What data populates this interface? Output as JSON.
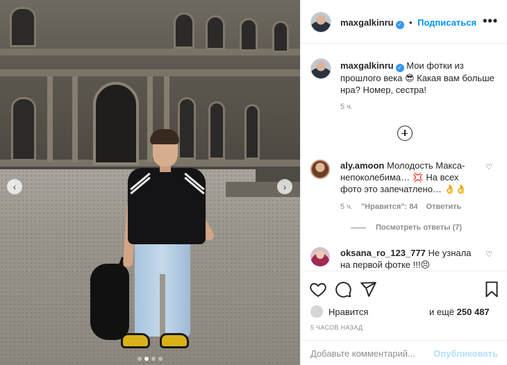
{
  "post": {
    "author": "maxgalkinru",
    "follow_label": "Подписаться",
    "more_icon": "•••",
    "caption_text": "Мои фотки из прошлого века 😎 Какая вам больше нра? Номер, сестра!",
    "caption_time": "5 ч."
  },
  "comments": [
    {
      "user": "aly.amoon",
      "text": "Молодость Макса-непоколебима… 💢 На всех фото это запечатлено… 👌👌",
      "time": "5 ч.",
      "likes": "\"Нравится\": 84",
      "reply_label": "Ответить",
      "view_replies": "Посмотреть ответы (7)"
    },
    {
      "user": "oksana_ro_123_777",
      "text": "Не узнала на первой фотке !!!😣"
    }
  ],
  "likes": {
    "label": "Нравится",
    "and_more": "и ещё",
    "count": "250 487"
  },
  "time_ago": "5 часов назад",
  "comment_input": {
    "placeholder": "Добавьте комментарий...",
    "post_label": "Опубликовать"
  },
  "carousel": {
    "prev_icon": "‹",
    "next_icon": "›",
    "slides": 4,
    "active_slide": 1
  },
  "colors": {
    "accent": "#0095f6",
    "post_disabled": "#b2dffc",
    "verified": "#3897f0"
  }
}
